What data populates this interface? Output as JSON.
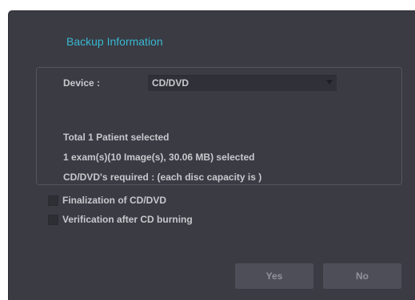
{
  "dialog": {
    "title": "Backup Information",
    "device_label": "Device :",
    "device_value": "CD/DVD",
    "summary": {
      "patients": "Total 1 Patient selected",
      "exams": "1 exam(s)(10 Image(s), 30.06 MB) selected",
      "discs": "CD/DVD's required :  (each disc capacity is )"
    },
    "options": [
      {
        "label": "Finalization of CD/DVD",
        "checked": false
      },
      {
        "label": "Verification after CD burning",
        "checked": false
      }
    ],
    "buttons": {
      "yes": "Yes",
      "no": "No"
    },
    "icons": {
      "dropdown": "chevron-down-icon"
    },
    "colors": {
      "background": "#3a3b43",
      "title": "#39b7d1",
      "text": "#c8c9cd",
      "button": "#4d4e57"
    }
  }
}
